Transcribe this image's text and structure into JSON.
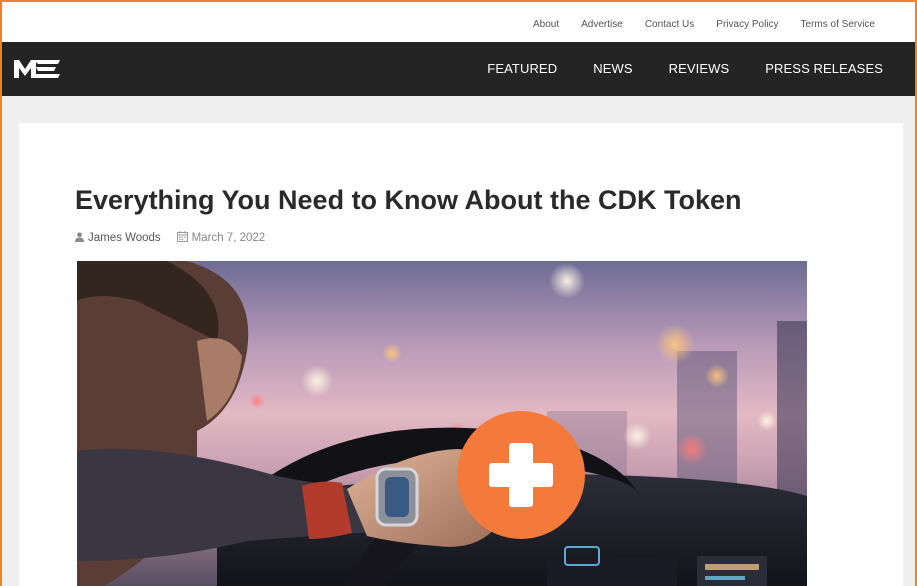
{
  "top_links": {
    "about": "About",
    "advertise": "Advertise",
    "contact": "Contact Us",
    "privacy": "Privacy Policy",
    "terms": "Terms of Service"
  },
  "nav": {
    "logo_text": "ME",
    "featured": "FEATURED",
    "news": "NEWS",
    "reviews": "REVIEWS",
    "press": "PRESS RELEASES"
  },
  "article": {
    "title": "Everything You Need to Know About the CDK Token",
    "author": "James Woods",
    "date": "March 7, 2022",
    "author_icon": "user-icon",
    "date_icon": "calendar-icon"
  },
  "hero_image": {
    "description_icon": "plus-icon"
  },
  "colors": {
    "accent": "#f47a3b",
    "nav_bg": "#242424",
    "frame_border": "#e8842c"
  }
}
